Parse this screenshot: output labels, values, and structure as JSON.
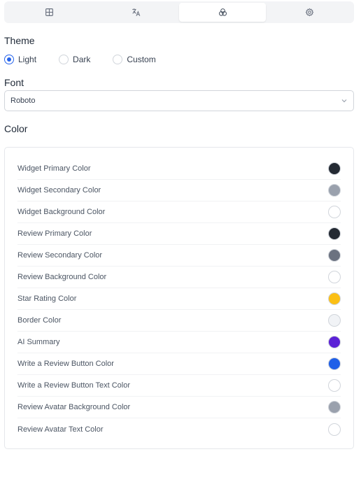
{
  "tabs": [
    {
      "icon": "layout-icon",
      "active": false
    },
    {
      "icon": "translate-icon",
      "active": false
    },
    {
      "icon": "palette-icon",
      "active": true
    },
    {
      "icon": "gear-icon",
      "active": false
    }
  ],
  "theme": {
    "title": "Theme",
    "options": [
      "Light",
      "Dark",
      "Custom"
    ],
    "selected": "Light"
  },
  "font": {
    "title": "Font",
    "value": "Roboto"
  },
  "color": {
    "title": "Color",
    "items": [
      {
        "label": "Widget Primary Color",
        "color": "#242a33"
      },
      {
        "label": "Widget Secondary Color",
        "color": "#9aa1ad"
      },
      {
        "label": "Widget Background Color",
        "color": "#ffffff"
      },
      {
        "label": "Review Primary Color",
        "color": "#242a33"
      },
      {
        "label": "Review Secondary Color",
        "color": "#6b7280"
      },
      {
        "label": "Review Background Color",
        "color": "#ffffff"
      },
      {
        "label": "Star Rating Color",
        "color": "#fbbf14"
      },
      {
        "label": "Border Color",
        "color": "#f1f3f6"
      },
      {
        "label": "AI Summary",
        "color": "#5b21d6"
      },
      {
        "label": "Write a Review Button Color",
        "color": "#1f5fe8"
      },
      {
        "label": "Write a Review Button Text Color",
        "color": "#ffffff"
      },
      {
        "label": "Review Avatar Background Color",
        "color": "#9aa1ad"
      },
      {
        "label": "Review Avatar Text Color",
        "color": "#ffffff"
      }
    ]
  }
}
